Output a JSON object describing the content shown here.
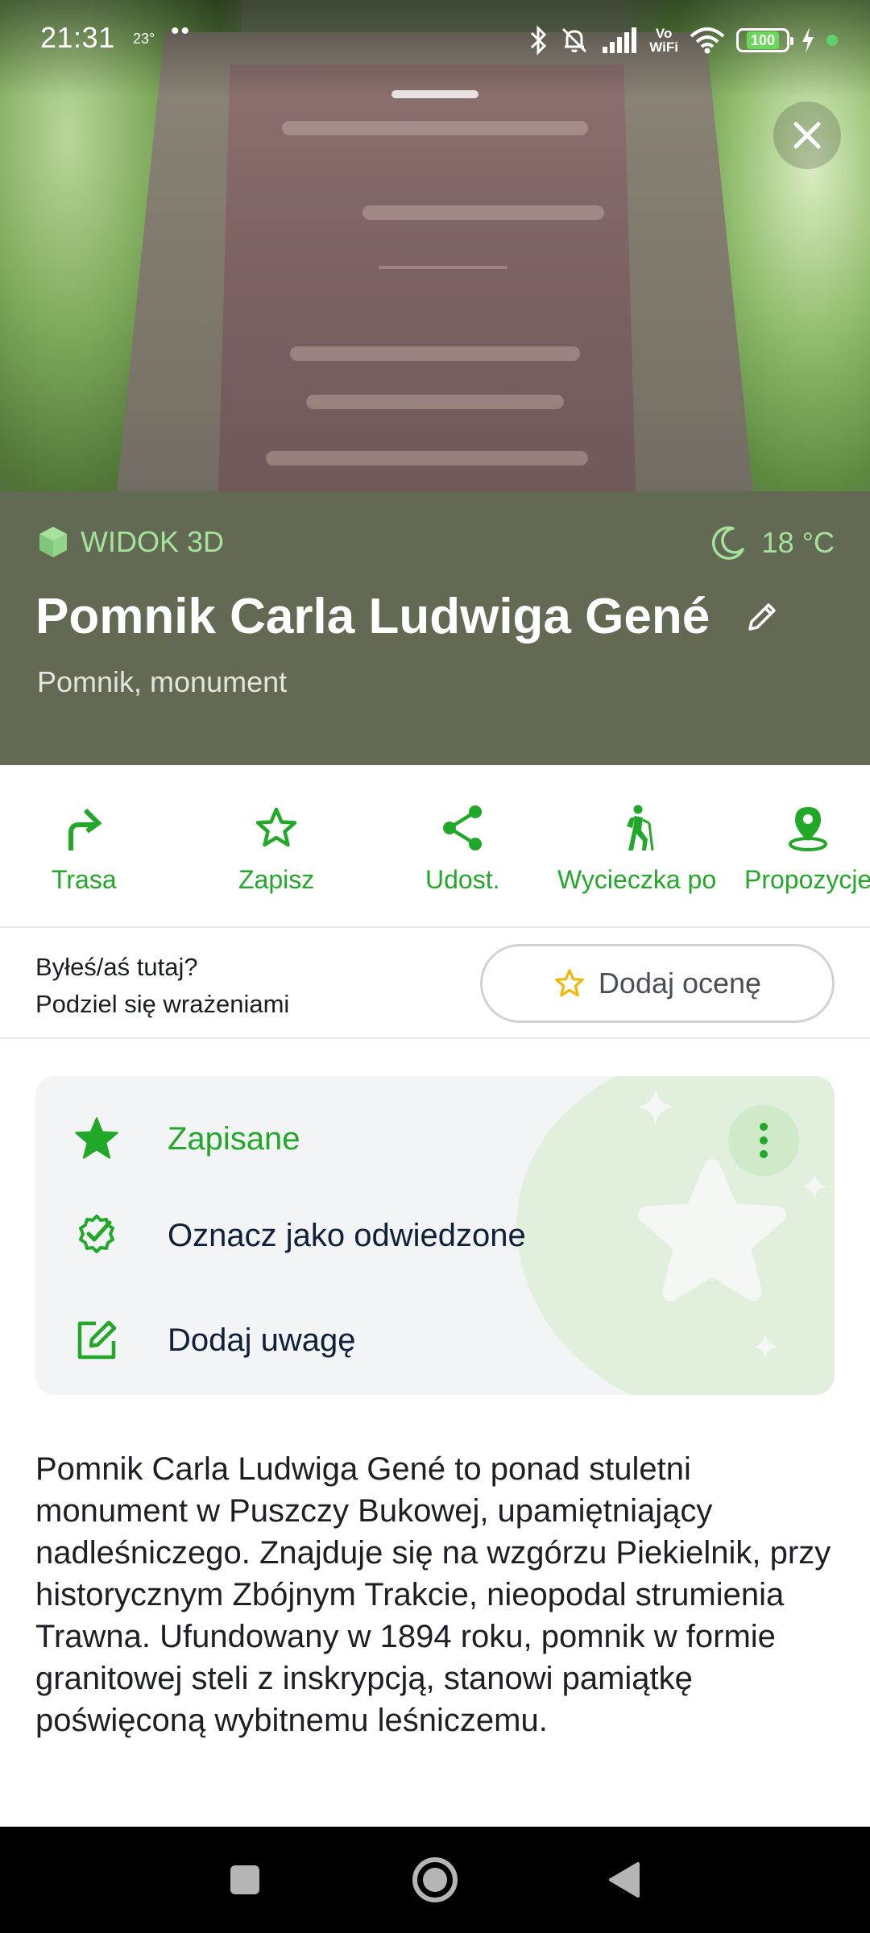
{
  "status_bar": {
    "time": "21:31",
    "temperature": "23°",
    "dots": "••",
    "volte_top": "Vo",
    "volte_bottom": "WiFi",
    "battery": "100"
  },
  "place": {
    "view_3d_label": "WIDOK 3D",
    "weather_temp": "18 °C",
    "title": "Pomnik Carla Ludwiga Gené",
    "category": "Pomnik, monument"
  },
  "actions": [
    {
      "label": "Trasa",
      "icon": "route-arrow-icon"
    },
    {
      "label": "Zapisz",
      "icon": "star-outline-icon"
    },
    {
      "label": "Udost.",
      "icon": "share-icon"
    },
    {
      "label": "Wycieczka po",
      "icon": "hiker-icon"
    },
    {
      "label": "Propozycje",
      "icon": "map-pin-icon"
    }
  ],
  "rating": {
    "prompt_line1": "Byłeś/aś tutaj?",
    "prompt_line2": "Podziel się wrażeniami",
    "button_label": "Dodaj ocenę"
  },
  "card": {
    "saved_label": "Zapisane",
    "visited_label": "Oznacz jako odwiedzone",
    "note_label": "Dodaj uwagę"
  },
  "description": "Pomnik Carla Ludwiga Gené to ponad stuletni monument w Puszczy Bukowej, upamiętniający nadleśniczego. Znajduje się na wzgórzu Piekielnik, przy historycznym Zbójnym Trakcie, nieopodal strumienia Trawna. Ufundowany w 1894 roku, pomnik w formie granitowej steli z inskrypcją, stanowi pamiątkę poświęconą wybitnemu leśniczemu.",
  "colors": {
    "accent_green": "#22a829",
    "header_band": "#636a53",
    "light_green": "#a6e29d",
    "star_yellow": "#f2b705"
  }
}
